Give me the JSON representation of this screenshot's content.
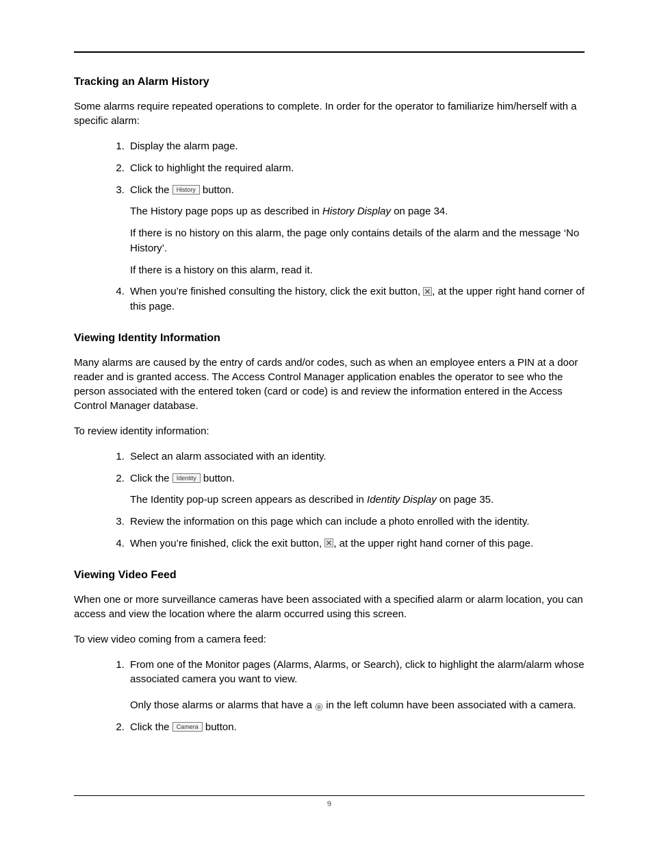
{
  "page_number": "9",
  "s1": {
    "heading": "Tracking an Alarm History",
    "intro": "Some alarms require repeated operations to complete. In order for the operator to familiarize him/herself with a specific alarm:",
    "step1": "Display the alarm page.",
    "step2": "Click to highlight the required alarm.",
    "step3_pre": "Click the ",
    "step3_btn": "History",
    "step3_post": " button.",
    "step3_a_pre": "The History page pops up as described in ",
    "step3_a_em": "History Display",
    "step3_a_post": " on page 34.",
    "step3_b": "If there is no history on this alarm, the page only contains details of the alarm and the message ‘No History’.",
    "step3_c": "If there is a history on this alarm, read it.",
    "step4_pre": "When you’re finished consulting the history, click the exit button, ",
    "step4_post": ", at the upper right hand corner of this page."
  },
  "s2": {
    "heading": "Viewing Identity Information",
    "intro": "Many alarms are caused by the entry of cards and/or codes, such as when an employee enters a PIN at a door reader and is granted access. The Access Control Manager application enables the operator to see who the person associated with the entered token (card or code) is and review the information entered in the Access Control Manager database.",
    "lead": "To review identity information:",
    "step1": "Select an alarm associated with an identity.",
    "step2_pre": "Click the ",
    "step2_btn": "Identity",
    "step2_post": " button.",
    "step2_a_pre": "The Identity pop-up screen appears as described in ",
    "step2_a_em": "Identity Display",
    "step2_a_post": " on page 35.",
    "step3": "Review the information on this page which can include a photo enrolled with the identity.",
    "step4_pre": "When you’re finished, click the exit button, ",
    "step4_post": ", at the upper right hand corner of this page."
  },
  "s3": {
    "heading": "Viewing Video Feed",
    "intro": "When one or more surveillance cameras have been associated with a specified alarm or alarm location, you can access and view the location where the alarm occurred using this screen.",
    "lead": "To view video coming from a camera feed:",
    "step1_a": "From one of the Monitor pages (Alarms, Alarms, or Search), click to highlight the alarm/alarm whose associated camera you want to view.",
    "step1_b_pre": "Only those alarms or alarms that have a ",
    "step1_b_post": " in the left column have been associated with a camera.",
    "step2_pre": "Click the ",
    "step2_btn": "Camera",
    "step2_post": " button."
  }
}
